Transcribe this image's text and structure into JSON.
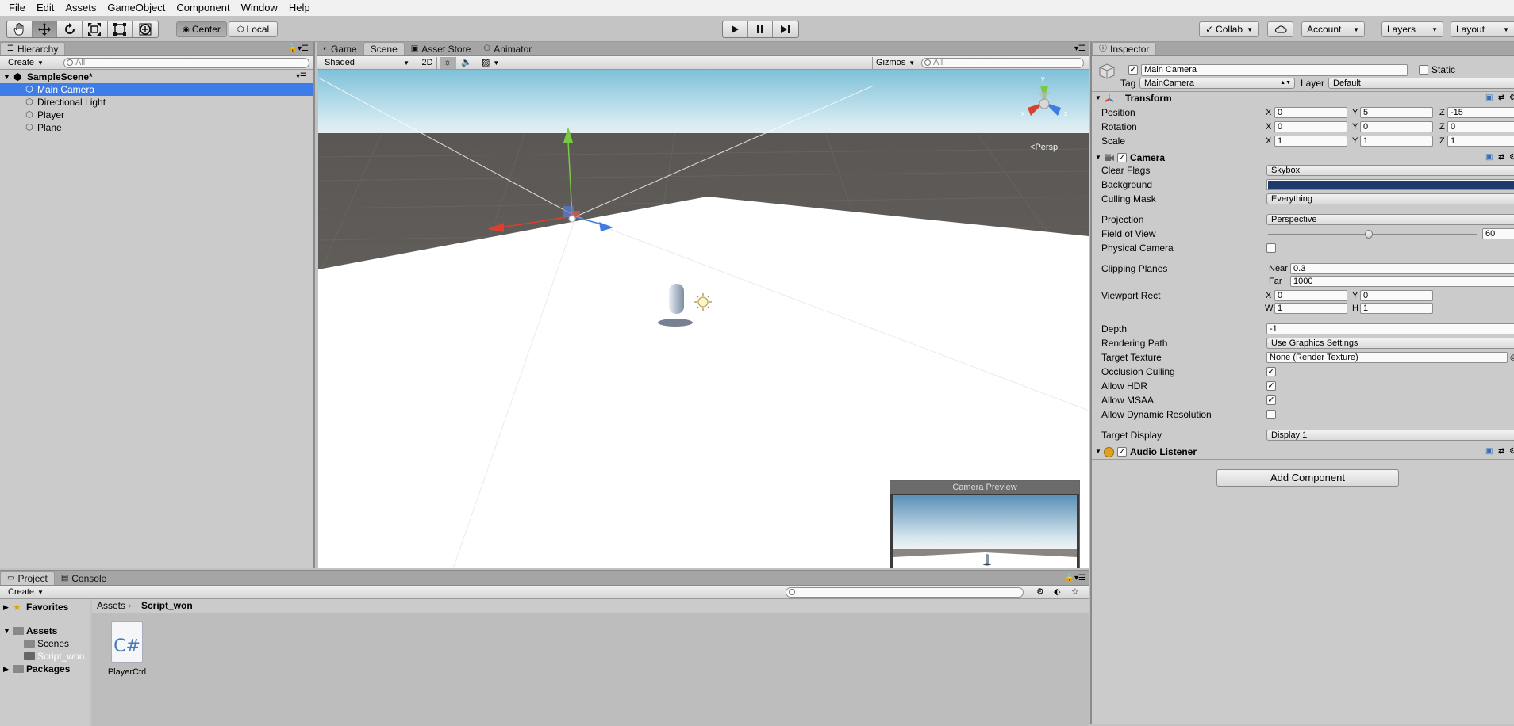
{
  "menubar": {
    "items": [
      "File",
      "Edit",
      "Assets",
      "GameObject",
      "Component",
      "Window",
      "Help"
    ]
  },
  "toolbar": {
    "tools": [
      "hand-icon",
      "move-icon",
      "rotate-icon",
      "scale-icon",
      "rect-icon",
      "transform-icon"
    ],
    "pivot": "Center",
    "space": "Local",
    "collab": "Collab",
    "account": "Account",
    "layers": "Layers",
    "layout": "Layout"
  },
  "hierarchy": {
    "tab": "Hierarchy",
    "create": "Create",
    "search_placeholder": "All",
    "scene": "SampleScene*",
    "items": [
      "Main Camera",
      "Directional Light",
      "Player",
      "Plane"
    ],
    "selected": "Main Camera"
  },
  "scene_view": {
    "tabs": [
      "Game",
      "Scene",
      "Asset Store",
      "Animator"
    ],
    "active_tab": "Scene",
    "shading": "Shaded",
    "mode_2d": "2D",
    "gizmos": "Gizmos",
    "search_placeholder": "All",
    "persp_label": "Persp",
    "gizmo_axes": {
      "x": "x",
      "y": "y",
      "z": "z"
    },
    "camera_preview_title": "Camera Preview"
  },
  "project": {
    "tabs": [
      "Project",
      "Console"
    ],
    "create": "Create",
    "favorites": "Favorites",
    "assets": "Assets",
    "folders": [
      "Scenes",
      "Script_won"
    ],
    "selected_folder": "Script_won",
    "packages": "Packages",
    "breadcrumb": [
      "Assets",
      "Script_won"
    ],
    "files": [
      {
        "name": "PlayerCtrl",
        "icon": "C#"
      }
    ]
  },
  "inspector": {
    "tab": "Inspector",
    "object_name": "Main Camera",
    "static_label": "Static",
    "tag_label": "Tag",
    "tag": "MainCamera",
    "layer_label": "Layer",
    "layer": "Default",
    "transform": {
      "title": "Transform",
      "position": {
        "label": "Position",
        "x": "0",
        "y": "5",
        "z": "-15"
      },
      "rotation": {
        "label": "Rotation",
        "x": "0",
        "y": "0",
        "z": "0"
      },
      "scale": {
        "label": "Scale",
        "x": "1",
        "y": "1",
        "z": "1"
      }
    },
    "camera": {
      "title": "Camera",
      "clear_flags_label": "Clear Flags",
      "clear_flags": "Skybox",
      "background_label": "Background",
      "background_color": "#1f3a6a",
      "culling_mask_label": "Culling Mask",
      "culling_mask": "Everything",
      "projection_label": "Projection",
      "projection": "Perspective",
      "fov_label": "Field of View",
      "fov": "60",
      "fov_fraction": 0.48,
      "physical_camera_label": "Physical Camera",
      "clipping_label": "Clipping Planes",
      "near_label": "Near",
      "near": "0.3",
      "far_label": "Far",
      "far": "1000",
      "viewport_label": "Viewport Rect",
      "vp_x": "0",
      "vp_y": "0",
      "vp_w": "1",
      "vp_h": "1",
      "depth_label": "Depth",
      "depth": "-1",
      "rendering_path_label": "Rendering Path",
      "rendering_path": "Use Graphics Settings",
      "target_texture_label": "Target Texture",
      "target_texture": "None (Render Texture)",
      "occlusion_label": "Occlusion Culling",
      "hdr_label": "Allow HDR",
      "msaa_label": "Allow MSAA",
      "dynres_label": "Allow Dynamic Resolution",
      "target_display_label": "Target Display",
      "target_display": "Display 1"
    },
    "audio_listener": {
      "title": "Audio Listener"
    },
    "add_component": "Add Component"
  },
  "colors": {
    "selection": "#3e7de7",
    "accent": "#4a90e2"
  }
}
